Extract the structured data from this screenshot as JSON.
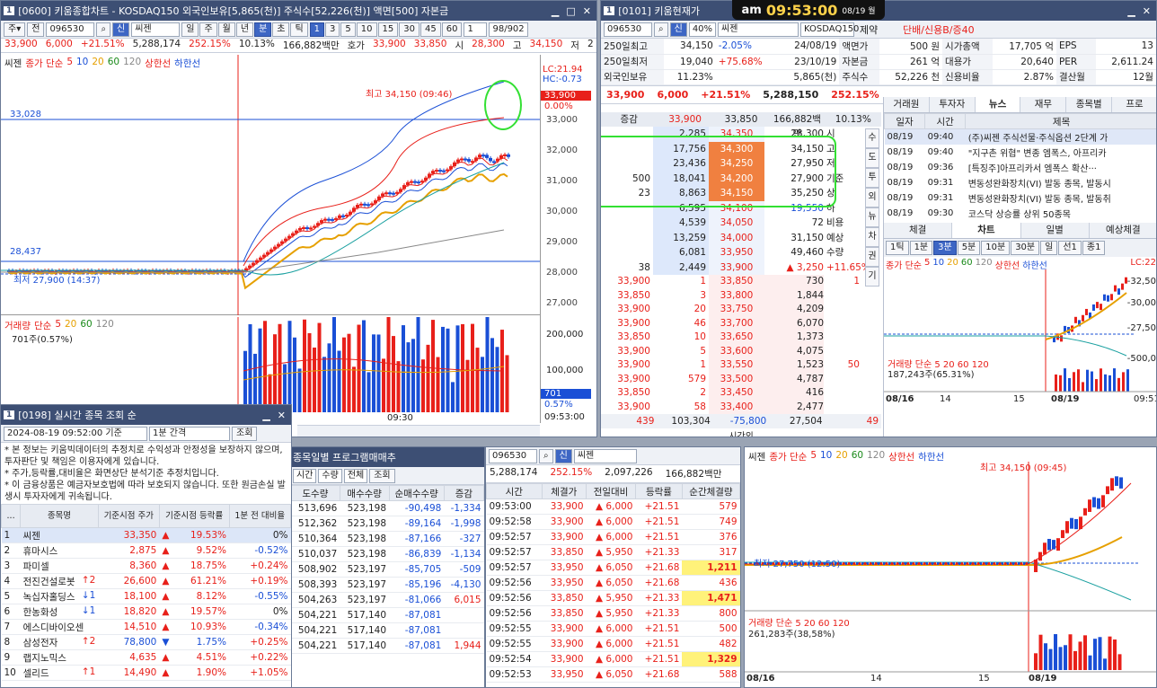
{
  "clock": {
    "ampm": "am",
    "time": "09:53:00",
    "date": "08/19 월"
  },
  "w600": {
    "title": "[0600] 키움종합차트 - KOSDAQ150 외국인보유[5,865(천)] 주식수[52,226(천)] 액면[500] 자본금",
    "code": "096530",
    "name": "씨젠",
    "periods": [
      "일",
      "주",
      "월",
      "년",
      "분",
      "초",
      "틱"
    ],
    "mins": [
      "1",
      "3",
      "5",
      "10",
      "15",
      "30",
      "45",
      "60"
    ],
    "count": "1",
    "page": "98/902",
    "info": [
      "33,900",
      "6,000",
      "+21.51%",
      "5,288,174",
      "252.15%",
      "10.13%",
      "166,882백만",
      "호가",
      "33,900",
      "33,850",
      "시",
      "28,300",
      "고",
      "34,150",
      "저",
      "2"
    ],
    "legend": [
      "씨젠",
      "종가 단순",
      "5",
      "10",
      "20",
      "60",
      "120",
      "상한선",
      "하한선"
    ],
    "lc": "LC:21.94",
    "hc": "HC:-0.73",
    "lastbadge": "33,900",
    "lastpct": "0.00%",
    "hi": "최고 34,150 (09:46)",
    "lo": "최저 27,900 (14:37)",
    "hline1": "33,028",
    "hline2": "28,437",
    "yticks": [
      "33,000",
      "32,000",
      "31,000",
      "30,000",
      "29,000",
      "28,000",
      "27,000"
    ],
    "vlegend": [
      "거래량",
      "단순",
      "5",
      "20",
      "60",
      "120"
    ],
    "vsub": "701주(0.57%)",
    "vticks": [
      "200,000",
      "100,000"
    ],
    "vbadge": "701",
    "vpct": "0.57%",
    "xlabel": "09:30",
    "tlabel": "09:53:00"
  },
  "w101": {
    "title": "[0101] 키움현재가",
    "code": "096530",
    "pct": "40%",
    "name": "씨젠",
    "mkt": "KOSDAQ150",
    "sector": "제약",
    "flag": "단배/신용B/증40",
    "rows": [
      [
        "250일최고",
        "34,150",
        "-2.05%",
        "24/08/19",
        "액면가",
        "500 원",
        "시가총액",
        "17,705 억",
        "EPS",
        "13"
      ],
      [
        "250일최저",
        "19,040",
        "+75.68%",
        "23/10/19",
        "자본금",
        "261 억",
        "대용가",
        "20,640",
        "PER",
        "2,611.24"
      ],
      [
        "외국인보유",
        "11.23%",
        "",
        "5,865(천)",
        "주식수",
        "52,226 천",
        "신용비율",
        "2.87%",
        "결산월",
        "12월"
      ]
    ],
    "price": "33,900",
    "chg": "6,000",
    "rate": "+21.51%",
    "vol": "5,288,150",
    "vr": "252.15%",
    "hdr": [
      "증감",
      "33,900",
      "33,850",
      "166,882백만",
      "10.13%"
    ],
    "ask": [
      [
        "",
        "2,285",
        "34,350",
        "28,300",
        "시"
      ],
      [
        "",
        "17,756",
        "34,300",
        "34,150",
        "고"
      ],
      [
        "",
        "23,436",
        "34,250",
        "27,950",
        "저"
      ],
      [
        "500",
        "18,041",
        "34,200",
        "27,900",
        "기준"
      ],
      [
        "23",
        "8,863",
        "34,150",
        "35,250",
        "상"
      ],
      [
        "",
        "6,595",
        "34,100",
        "19,550",
        "하"
      ],
      [
        "",
        "4,539",
        "34,050",
        "72",
        "비용"
      ],
      [
        "",
        "13,259",
        "34,000",
        "31,150",
        "예상"
      ],
      [
        "",
        "6,081",
        "33,950",
        "49,460",
        "수량"
      ],
      [
        "38",
        "2,449",
        "33,900",
        "▲ 3,250",
        "+11.65%"
      ]
    ],
    "bid": [
      [
        "33,900",
        "1",
        "33,850",
        "730",
        "1"
      ],
      [
        "33,850",
        "3",
        "33,800",
        "1,844",
        ""
      ],
      [
        "33,900",
        "20",
        "33,750",
        "4,209",
        ""
      ],
      [
        "33,900",
        "46",
        "33,700",
        "6,070",
        ""
      ],
      [
        "33,850",
        "10",
        "33,650",
        "1,373",
        ""
      ],
      [
        "33,900",
        "5",
        "33,600",
        "4,075",
        ""
      ],
      [
        "33,900",
        "1",
        "33,550",
        "1,523",
        "50"
      ],
      [
        "33,900",
        "579",
        "33,500",
        "4,787",
        ""
      ],
      [
        "33,850",
        "2",
        "33,450",
        "416",
        ""
      ],
      [
        "33,900",
        "58",
        "33,400",
        "2,477",
        ""
      ]
    ],
    "foot": [
      "439",
      "103,304",
      "-75,800",
      "27,504",
      "49"
    ],
    "footlbl": "시간외",
    "side": [
      "수",
      "도",
      "투",
      "외",
      "뉴",
      "차",
      "권",
      "기"
    ],
    "tabs": [
      "거래원",
      "투자자",
      "뉴스",
      "재무",
      "종목별",
      "프로"
    ],
    "news_h": [
      "일자",
      "시간",
      "제목"
    ],
    "news": [
      [
        "08/19",
        "09:40",
        "(주)씨젠 주식선물·주식옵션 2단계 가"
      ],
      [
        "08/19",
        "09:40",
        "\"지구촌 위협\" 변종 엠폭스, 아프리카"
      ],
      [
        "08/19",
        "09:36",
        "[특징주]아프리카서 엠폭스 확산···"
      ],
      [
        "08/19",
        "09:31",
        "변동성완화장치(VI) 발동 종목, 발동시"
      ],
      [
        "08/19",
        "09:31",
        "변동성완화장치(VI) 발동 종목, 발동취"
      ],
      [
        "08/19",
        "09:30",
        "코스닥 상승률 상위 50종목"
      ]
    ],
    "tabs2": [
      "체결",
      "차트",
      "일별",
      "예상체결"
    ],
    "tf": [
      "1틱",
      "1분",
      "3분",
      "5분",
      "10분",
      "30분",
      "일",
      "선1",
      "종1"
    ],
    "mlegend": [
      "종가 단순",
      "5",
      "10",
      "20",
      "60",
      "120",
      "상한선",
      "하한선"
    ],
    "mvol": "거래량 단순 5 20 60 120",
    "mvsub": "187,243주(65.31%)",
    "mdates": [
      "08/16",
      "14",
      "15",
      "08/19",
      "09:51"
    ],
    "mticks": [
      "-32,50",
      "-30,00",
      "-27,50",
      "-500,0"
    ],
    "mlc": "LC:22"
  },
  "w198": {
    "title": "[0198] 실시간 종목 조회 순",
    "date": "2024-08-19 09:52:00 기준",
    "interval": "1분 간격",
    "btn": "조회",
    "notice": [
      "* 본 정보는 키움빅데이터의 추정치로 수익성과 안정성을 보장하지 않으며, 투자판단 및 책임은 이용자에게 있습니다.",
      "* 주가,등락률,대비율은 화면상단 분석기준 추정치입니다.",
      "* 이 금융상품은 예금자보호법에 따라 보호되지 않습니다. 또한 원금손실 발생시 투자자에게 귀속됩니다."
    ],
    "heads": [
      "...",
      "종목명",
      "기준시점 주가",
      "기준시점 등락률",
      "1분 전 대비율"
    ],
    "rows": [
      [
        "1",
        "씨젠",
        "",
        "33,350",
        "▲",
        "19.53%",
        "0%"
      ],
      [
        "2",
        "휴마시스",
        "",
        "2,875",
        "▲",
        "9.52%",
        "-0.52%"
      ],
      [
        "3",
        "파미셀",
        "",
        "8,360",
        "▲",
        "18.75%",
        "+0.24%"
      ],
      [
        "4",
        "전진건설로봇",
        "↑2",
        "26,600",
        "▲",
        "61.21%",
        "+0.19%"
      ],
      [
        "5",
        "녹십자홀딩스",
        "↓1",
        "18,100",
        "▲",
        "8.12%",
        "-0.55%"
      ],
      [
        "6",
        "한농화성",
        "↓1",
        "18,820",
        "▲",
        "19.57%",
        "0%"
      ],
      [
        "7",
        "에스디바이오센",
        "",
        "14,510",
        "▲",
        "10.93%",
        "-0.34%"
      ],
      [
        "8",
        "삼성전자",
        "↑2",
        "78,800",
        "▼",
        "1.75%",
        "+0.25%"
      ],
      [
        "9",
        "랩지노믹스",
        "",
        "4,635",
        "▲",
        "4.51%",
        "+0.22%"
      ],
      [
        "10",
        "셀리드",
        "↑1",
        "14,490",
        "▲",
        "1.90%",
        "+1.05%"
      ]
    ]
  },
  "wprog": {
    "title": "종목일별 프로그램매매추",
    "sel": [
      "시간",
      "수량",
      "전체"
    ],
    "btn": "조회",
    "heads": [
      "도수량",
      "매수수량",
      "순매수수량",
      "증감"
    ],
    "rows": [
      [
        "513,696",
        "523,198",
        "-90,498",
        "-1,334"
      ],
      [
        "512,362",
        "523,198",
        "-89,164",
        "-1,998"
      ],
      [
        "510,364",
        "523,198",
        "-87,166",
        "-327"
      ],
      [
        "510,037",
        "523,198",
        "-86,839",
        "-1,134"
      ],
      [
        "508,902",
        "523,197",
        "-85,705",
        "-509"
      ],
      [
        "508,393",
        "523,197",
        "-85,196",
        "-4,130"
      ],
      [
        "504,263",
        "523,197",
        "-81,066",
        "6,015"
      ],
      [
        "504,221",
        "517,140",
        "-87,081",
        ""
      ],
      [
        "504,221",
        "517,140",
        "-87,081",
        ""
      ],
      [
        "504,221",
        "517,140",
        "-87,081",
        "1,944"
      ]
    ]
  },
  "wtick": {
    "code": "096530",
    "name": "씨젠",
    "sum": [
      "5,288,174",
      "252.15%",
      "2,097,226",
      "166,882백만"
    ],
    "heads": [
      "시간",
      "체결가",
      "전일대비",
      "등락률",
      "순간체결량"
    ],
    "rows": [
      [
        "09:53:00",
        "33,900",
        "6,000",
        "+21.51",
        "579",
        ""
      ],
      [
        "09:52:58",
        "33,900",
        "6,000",
        "+21.51",
        "749",
        ""
      ],
      [
        "09:52:57",
        "33,900",
        "6,000",
        "+21.51",
        "376",
        ""
      ],
      [
        "09:52:57",
        "33,850",
        "5,950",
        "+21.33",
        "317",
        ""
      ],
      [
        "09:52:57",
        "33,950",
        "6,050",
        "+21.68",
        "1,211",
        "y"
      ],
      [
        "09:52:56",
        "33,950",
        "6,050",
        "+21.68",
        "436",
        ""
      ],
      [
        "09:52:56",
        "33,850",
        "5,950",
        "+21.33",
        "1,471",
        "y"
      ],
      [
        "09:52:56",
        "33,850",
        "5,950",
        "+21.33",
        "800",
        ""
      ],
      [
        "09:52:55",
        "33,900",
        "6,000",
        "+21.51",
        "500",
        ""
      ],
      [
        "09:52:55",
        "33,900",
        "6,000",
        "+21.51",
        "482",
        ""
      ],
      [
        "09:52:54",
        "33,900",
        "6,000",
        "+21.51",
        "1,329",
        "y"
      ],
      [
        "09:52:53",
        "33,950",
        "6,050",
        "+21.68",
        "588",
        ""
      ]
    ]
  },
  "wchart2": {
    "name": "씨젠",
    "legend": [
      "종가 단순",
      "5",
      "10",
      "20",
      "60",
      "120",
      "상한선",
      "하한선"
    ],
    "hi": "최고 34,150 (09:45)",
    "lo": "최저 27,750 (12:50)",
    "vlegend": "거래량 단순 5 20 60 120",
    "vsub": "261,283주(38,58%)",
    "dates": [
      "08/16",
      "14",
      "15",
      "08/19"
    ]
  }
}
